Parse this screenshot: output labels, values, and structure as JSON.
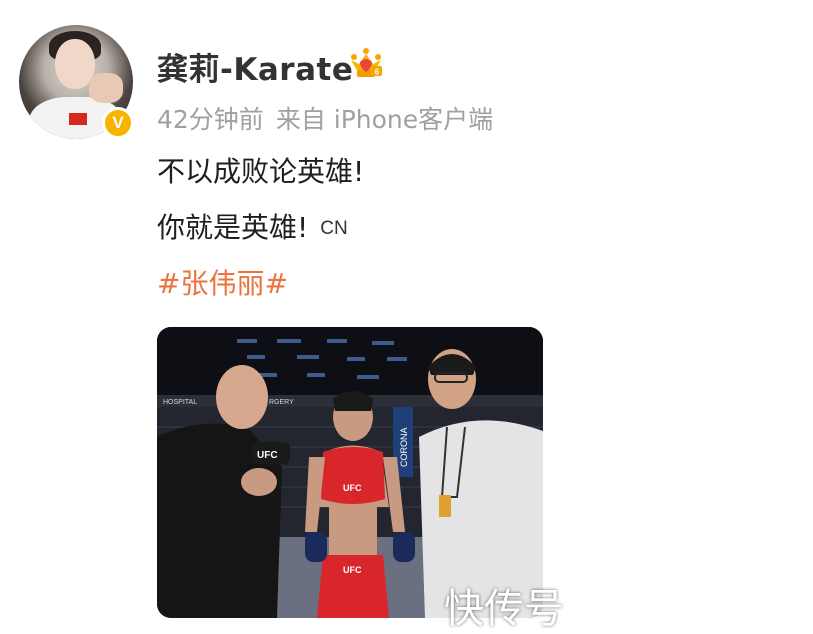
{
  "post": {
    "author": "龚莉-Karate",
    "member_badge": "crown-membership-icon",
    "verified_badge": "V",
    "time": "42分钟前",
    "source": "来自 iPhone客户端",
    "text_line_1": "不以成败论英雄!",
    "text_line_2": "你就是英雄!",
    "emoji": "CN",
    "topic": "#张伟丽#",
    "photo_labels": {
      "ufc_mic": "UFC",
      "ufc_top": "UFC",
      "ufc_shorts": "UFC",
      "banner_left": "HOSPITAL",
      "banner_right": "RGERY",
      "sponsor": "CORONA"
    },
    "watermark": "快传号"
  },
  "colors": {
    "topic": "#eb7340",
    "meta": "#a0a0a0",
    "verified": "#f7b500",
    "fighter_top": "#d8262b"
  }
}
